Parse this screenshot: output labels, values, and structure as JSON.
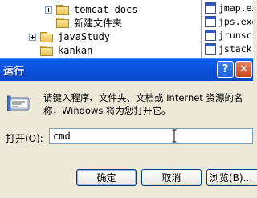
{
  "explorer": {
    "tree": [
      {
        "label": "tomcat-docs",
        "expander": true
      },
      {
        "label": "新建文件夹",
        "expander": false
      },
      {
        "label": "javaStudy",
        "expander": true
      },
      {
        "label": "kankan",
        "expander": false
      }
    ],
    "files": [
      "jmap.exe",
      "jps.exe",
      "jrunscr",
      "jstack."
    ]
  },
  "dialog": {
    "title": "运行",
    "help_glyph": "?",
    "close_glyph": "✕",
    "description": "请键入程序、文件夹、文档或 Internet 资源的名\n称，Windows 将为您打开它。",
    "open_label": "打开(O):",
    "command_value": "cmd",
    "ok_label": "确定",
    "cancel_label": "取消",
    "browse_label": "浏览(B)..."
  }
}
